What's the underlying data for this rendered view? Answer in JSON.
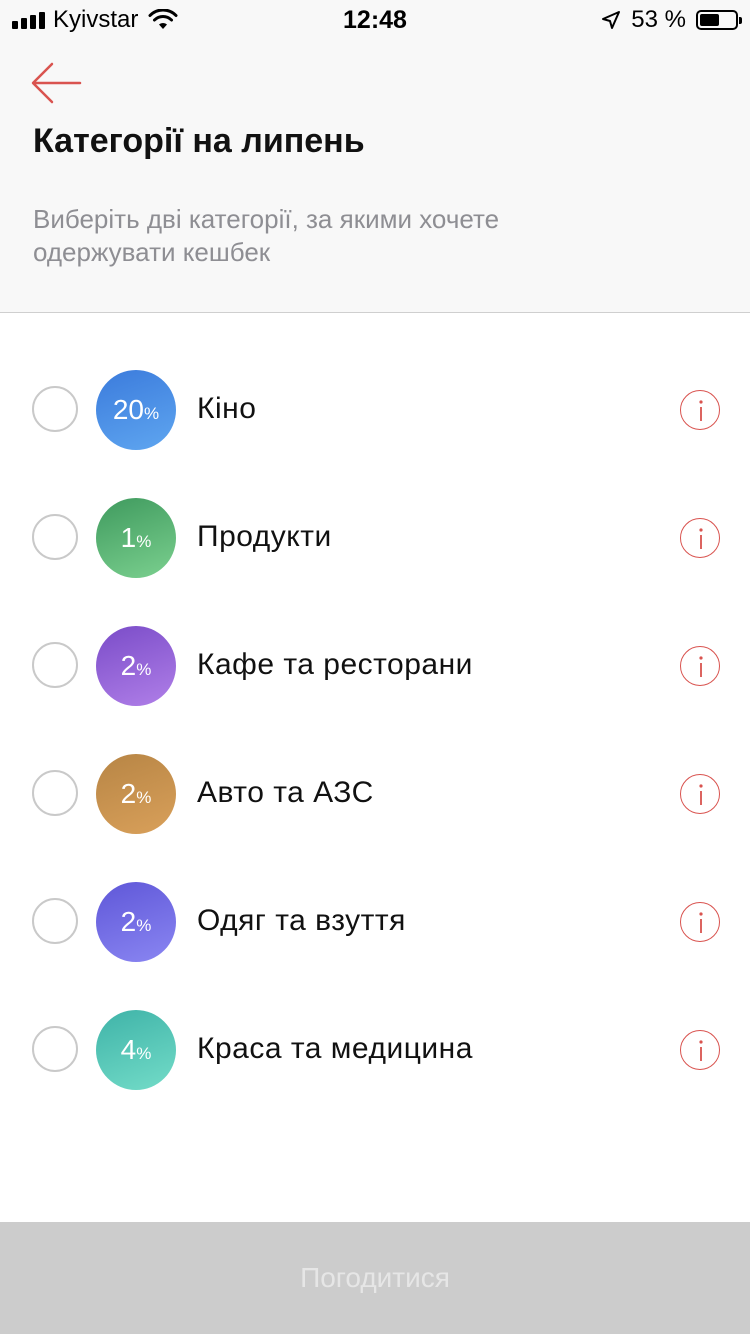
{
  "status_bar": {
    "carrier": "Kyivstar",
    "time": "12:48",
    "battery": "53 %"
  },
  "header": {
    "title": "Категорії на липень",
    "subtitle": "Виберіть дві категорії, за якими хочете одержувати кешбек"
  },
  "categories": [
    {
      "label": "Кіно",
      "value": "20",
      "unit": "%",
      "color_from": "#3b7bdc",
      "color_to": "#5fa6f0"
    },
    {
      "label": "Продукти",
      "value": "1",
      "unit": "%",
      "color_from": "#3f9a5e",
      "color_to": "#7bd08f"
    },
    {
      "label": "Кафе та ресторани",
      "value": "2",
      "unit": "%",
      "color_from": "#7a4cc8",
      "color_to": "#b07fe8"
    },
    {
      "label": "Авто та АЗС",
      "value": "2",
      "unit": "%",
      "color_from": "#b78545",
      "color_to": "#d9a05a"
    },
    {
      "label": "Одяг та взуття",
      "value": "2",
      "unit": "%",
      "color_from": "#5f57d8",
      "color_to": "#8a86f2"
    },
    {
      "label": "Краса та медицина",
      "value": "4",
      "unit": "%",
      "color_from": "#3fb3a8",
      "color_to": "#73dcc8"
    }
  ],
  "footer": {
    "button_label": "Погодитися"
  },
  "colors": {
    "accent": "#d9534f",
    "disabled_button": "#cccccc"
  }
}
